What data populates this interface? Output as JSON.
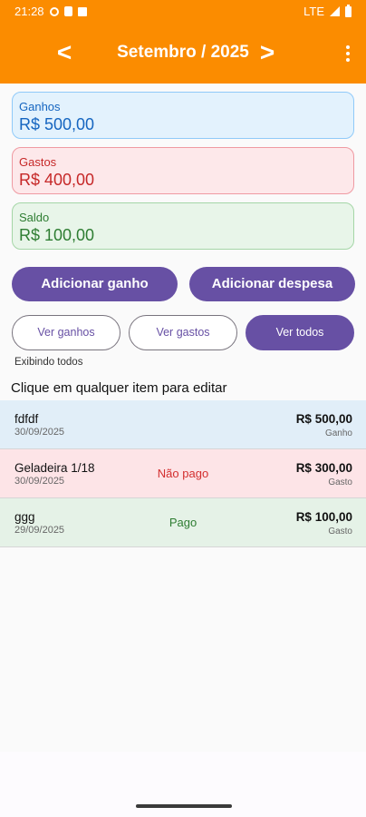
{
  "status_bar": {
    "time": "21:28",
    "network": "LTE",
    "icons": [
      "shield-icon",
      "sim-card-icon",
      "notification-icon",
      "signal-icon",
      "battery-icon"
    ]
  },
  "header": {
    "title": "Setembro / 2025",
    "prev_label": "<",
    "next_label": ">",
    "background_color": "#fb8c00"
  },
  "summary": {
    "ganhos": {
      "label": "Ganhos",
      "value": "R$ 500,00"
    },
    "gastos": {
      "label": "Gastos",
      "value": "R$ 400,00"
    },
    "saldo": {
      "label": "Saldo",
      "value": "R$ 100,00"
    }
  },
  "actions": {
    "add_income": "Adicionar ganho",
    "add_expense": "Adicionar despesa"
  },
  "filters": {
    "items": [
      "Ver ganhos",
      "Ver gastos",
      "Ver todos"
    ],
    "selected": "Ver todos",
    "status_text": "Exibindo todos"
  },
  "hint": "Clique em qualquer item para editar",
  "items": [
    {
      "name": "fdfdf",
      "date": "30/09/2025",
      "status": "",
      "amount": "R$ 500,00",
      "kind": "Ganho"
    },
    {
      "name": "Geladeira 1/18",
      "date": "30/09/2025",
      "status": "Não pago",
      "amount": "R$ 300,00",
      "kind": "Gasto"
    },
    {
      "name": "ggg",
      "date": "29/09/2025",
      "status": "Pago",
      "amount": "R$ 100,00",
      "kind": "Gasto"
    }
  ],
  "colors": {
    "accent": "#6750a4",
    "income": "#1565c0",
    "expense": "#c62828",
    "balance": "#2e7d32"
  }
}
